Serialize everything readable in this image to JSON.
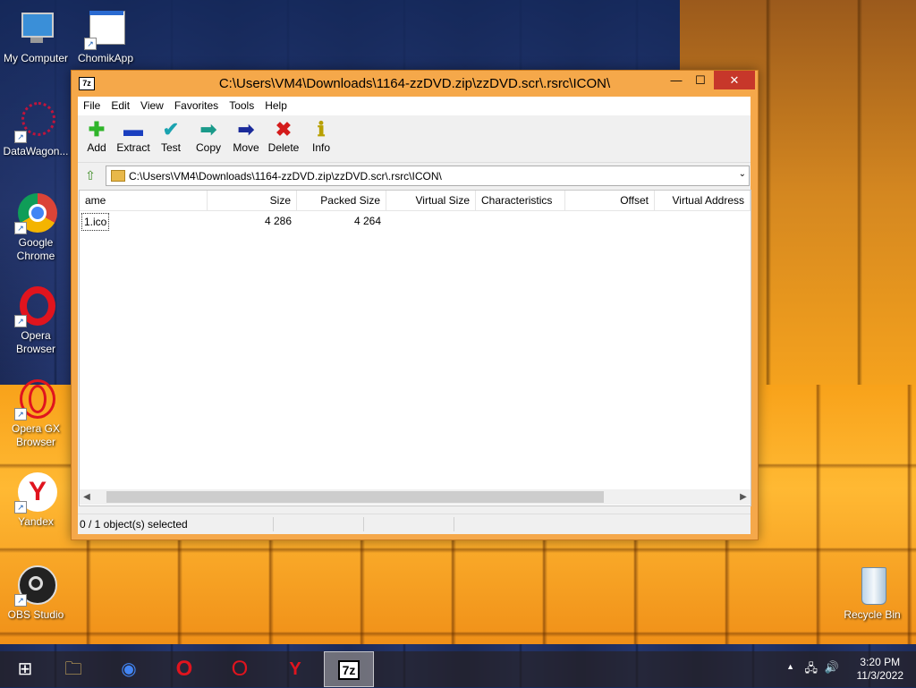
{
  "desktop": {
    "icons": [
      {
        "label": "My Computer"
      },
      {
        "label": "ChomikApp"
      },
      {
        "label": "DataWagon..."
      },
      {
        "label": "Google Chrome"
      },
      {
        "label": "Opera Browser"
      },
      {
        "label": "Opera GX Browser"
      },
      {
        "label": "Yandex"
      },
      {
        "label": "OBS Studio"
      },
      {
        "label": "Recycle Bin"
      }
    ]
  },
  "window": {
    "app_icon": "7z",
    "title": "C:\\Users\\VM4\\Downloads\\1164-zzDVD.zip\\zzDVD.scr\\.rsrc\\ICON\\",
    "minimize": "—",
    "maximize": "☐",
    "close": "✕",
    "menu": [
      "File",
      "Edit",
      "View",
      "Favorites",
      "Tools",
      "Help"
    ],
    "toolbar": [
      {
        "label": "Add",
        "icon": "add-icon",
        "glyph": "✚",
        "color": "#2fb52a"
      },
      {
        "label": "Extract",
        "icon": "extract-icon",
        "glyph": "▬",
        "color": "#1a3fbf"
      },
      {
        "label": "Test",
        "icon": "test-icon",
        "glyph": "✔",
        "color": "#1aa3b0"
      },
      {
        "label": "Copy",
        "icon": "copy-icon",
        "glyph": "➡",
        "color": "#1a9a8a"
      },
      {
        "label": "Move",
        "icon": "move-icon",
        "glyph": "➡",
        "color": "#1a2a9a"
      },
      {
        "label": "Delete",
        "icon": "delete-icon",
        "glyph": "✖",
        "color": "#d41b1b"
      },
      {
        "label": "Info",
        "icon": "info-icon",
        "glyph": "ℹ",
        "color": "#b8a000"
      }
    ],
    "address": "C:\\Users\\VM4\\Downloads\\1164-zzDVD.zip\\zzDVD.scr\\.rsrc\\ICON\\",
    "columns": [
      "ame",
      "Size",
      "Packed Size",
      "Virtual Size",
      "Characteristics",
      "Offset",
      "Virtual Address"
    ],
    "rows": [
      {
        "name": "1.ico",
        "size": "4 286",
        "packed_size": "4 264"
      }
    ],
    "status": "0 / 1 object(s) selected"
  },
  "taskbar": {
    "items": [
      {
        "name": "start",
        "glyph": "⊞"
      },
      {
        "name": "file-explorer",
        "glyph": "🗀"
      },
      {
        "name": "chrome",
        "glyph": "◉"
      },
      {
        "name": "opera",
        "glyph": "O"
      },
      {
        "name": "opera-gx",
        "glyph": "O"
      },
      {
        "name": "yandex",
        "glyph": "Y"
      },
      {
        "name": "7zip",
        "glyph": "7z"
      }
    ],
    "time": "3:20 PM",
    "date": "11/3/2022"
  }
}
